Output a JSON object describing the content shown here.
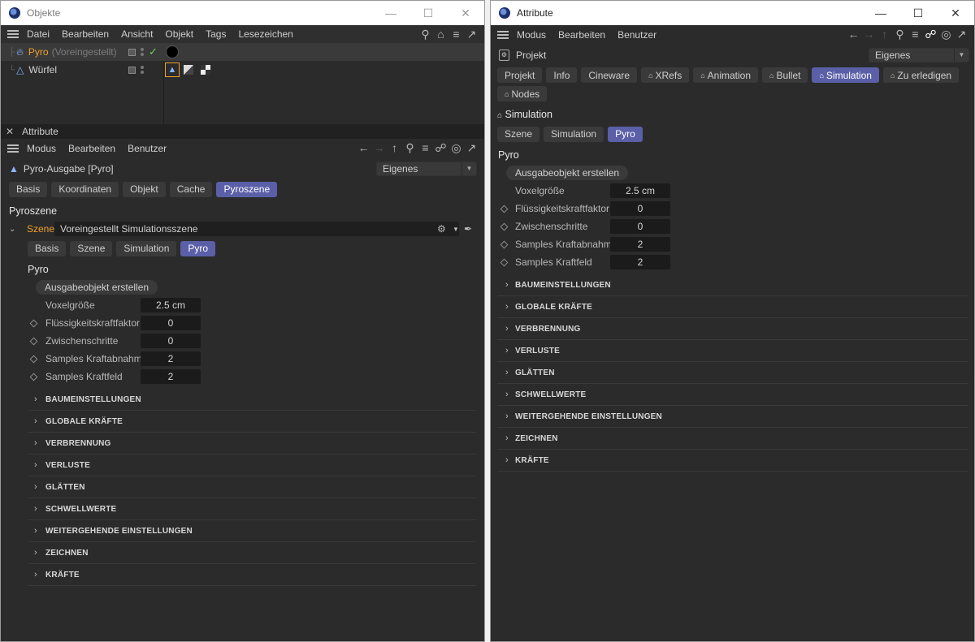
{
  "left_window": {
    "title": "Objekte",
    "menu": [
      "Datei",
      "Bearbeiten",
      "Ansicht",
      "Objekt",
      "Tags",
      "Lesezeichen"
    ],
    "objects": [
      {
        "name": "Pyro",
        "suffix": "(Voreingestellt)"
      },
      {
        "name": "Würfel",
        "suffix": ""
      }
    ],
    "attr_panel": {
      "title": "Attribute",
      "menu": [
        "Modus",
        "Bearbeiten",
        "Benutzer"
      ],
      "object_label": "Pyro-Ausgabe [Pyro]",
      "mode": "Eigenes",
      "tabs": [
        "Basis",
        "Koordinaten",
        "Objekt",
        "Cache",
        "Pyroszene"
      ],
      "active_tab": "Pyroszene",
      "section": "Pyroszene",
      "scene_label": "Szene",
      "scene_value": "Voreingestellt Simulationsszene",
      "subtabs": [
        "Basis",
        "Szene",
        "Simulation",
        "Pyro"
      ],
      "active_subtab": "Pyro",
      "group_title": "Pyro",
      "output_button": "Ausgabeobjekt erstellen",
      "params": [
        {
          "label": "Voxelgröße",
          "value": "2.5 cm",
          "animatable": false
        },
        {
          "label": "Flüssigkeitskraftfaktor",
          "value": "0",
          "animatable": true
        },
        {
          "label": "Zwischenschritte",
          "value": "0",
          "animatable": true
        },
        {
          "label": "Samples Kraftabnahme",
          "value": "2",
          "animatable": true
        },
        {
          "label": "Samples Kraftfeld",
          "value": "2",
          "animatable": true
        }
      ],
      "groups": [
        "BAUMEINSTELLUNGEN",
        "GLOBALE KRÄFTE",
        "VERBRENNUNG",
        "VERLUSTE",
        "GLÄTTEN",
        "SCHWELLWERTE",
        "WEITERGEHENDE EINSTELLUNGEN",
        "ZEICHNEN",
        "KRÄFTE"
      ]
    }
  },
  "right_window": {
    "title": "Attribute",
    "menu": [
      "Modus",
      "Bearbeiten",
      "Benutzer"
    ],
    "object_label": "Projekt",
    "mode": "Eigenes",
    "tabs": [
      "Projekt",
      "Info",
      "Cineware",
      "XRefs",
      "Animation",
      "Bullet",
      "Simulation",
      "Zu erledigen",
      "Nodes"
    ],
    "tab_has_icon": [
      false,
      false,
      false,
      true,
      true,
      true,
      true,
      true,
      true
    ],
    "active_tab": "Simulation",
    "section": "Simulation",
    "subtabs": [
      "Szene",
      "Simulation",
      "Pyro"
    ],
    "active_subtab": "Pyro",
    "group_title": "Pyro",
    "output_button": "Ausgabeobjekt erstellen",
    "params": [
      {
        "label": "Voxelgröße",
        "value": "2.5 cm",
        "animatable": false
      },
      {
        "label": "Flüssigkeitskraftfaktor",
        "value": "0",
        "animatable": true
      },
      {
        "label": "Zwischenschritte",
        "value": "0",
        "animatable": true
      },
      {
        "label": "Samples Kraftabnahme",
        "value": "2",
        "animatable": true
      },
      {
        "label": "Samples Kraftfeld",
        "value": "2",
        "animatable": true
      }
    ],
    "groups": [
      "BAUMEINSTELLUNGEN",
      "GLOBALE KRÄFTE",
      "VERBRENNUNG",
      "VERLUSTE",
      "GLÄTTEN",
      "SCHWELLWERTE",
      "WEITERGEHENDE EINSTELLUNGEN",
      "ZEICHNEN",
      "KRÄFTE"
    ]
  },
  "colors": {
    "accent": "#5a5fa8",
    "highlight": "#f0a02a",
    "panel": "#2b2b2b"
  }
}
